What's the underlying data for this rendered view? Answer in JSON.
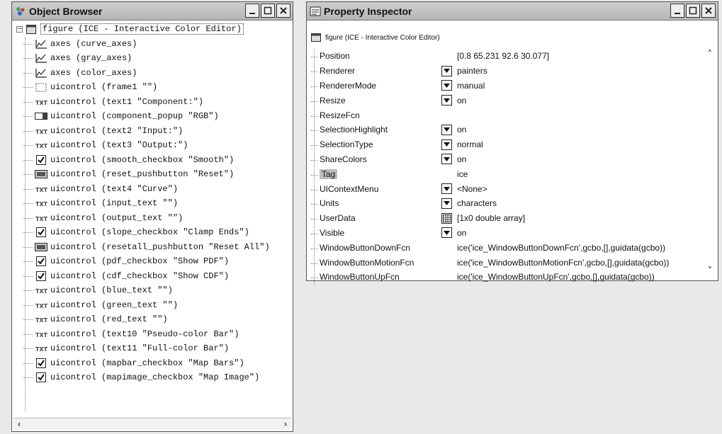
{
  "object_browser": {
    "title": "Object Browser",
    "root": {
      "expander": "−",
      "label": "figure (ICE - Interactive Color Editor)"
    },
    "items": [
      {
        "icon": "axes-icon",
        "label": "axes (curve_axes)"
      },
      {
        "icon": "axes-icon",
        "label": "axes (gray_axes)"
      },
      {
        "icon": "axes-icon",
        "label": "axes (color_axes)"
      },
      {
        "icon": "frame-icon",
        "label": "uicontrol (frame1 \"\")"
      },
      {
        "icon": "text-icon",
        "label": "uicontrol (text1 \"Component:\")"
      },
      {
        "icon": "popup-icon",
        "label": "uicontrol (component_popup \"RGB\")"
      },
      {
        "icon": "text-icon",
        "label": "uicontrol (text2 \"Input:\")"
      },
      {
        "icon": "text-icon",
        "label": "uicontrol (text3 \"Output:\")"
      },
      {
        "icon": "checkbox-icon",
        "label": "uicontrol (smooth_checkbox \"Smooth\")"
      },
      {
        "icon": "pushbutton-icon",
        "label": "uicontrol (reset_pushbutton \"Reset\")"
      },
      {
        "icon": "text-icon",
        "label": "uicontrol (text4 \"Curve\")"
      },
      {
        "icon": "text-icon",
        "label": "uicontrol (input_text \"\")"
      },
      {
        "icon": "text-icon",
        "label": "uicontrol (output_text \"\")"
      },
      {
        "icon": "checkbox-icon",
        "label": "uicontrol (slope_checkbox \"Clamp Ends\")"
      },
      {
        "icon": "pushbutton-icon",
        "label": "uicontrol (resetall_pushbutton \"Reset All\")"
      },
      {
        "icon": "checkbox-icon",
        "label": "uicontrol (pdf_checkbox \"Show PDF\")"
      },
      {
        "icon": "checkbox-icon",
        "label": "uicontrol (cdf_checkbox \"Show CDF\")"
      },
      {
        "icon": "text-icon",
        "label": "uicontrol (blue_text \"\")"
      },
      {
        "icon": "text-icon",
        "label": "uicontrol (green_text \"\")"
      },
      {
        "icon": "text-icon",
        "label": "uicontrol (red_text \"\")"
      },
      {
        "icon": "text-icon",
        "label": "uicontrol (text10 \"Pseudo-color Bar\")"
      },
      {
        "icon": "text-icon",
        "label": "uicontrol (text11 \"Full-color Bar\")"
      },
      {
        "icon": "checkbox-icon",
        "label": "uicontrol (mapbar_checkbox \"Map Bars\")"
      },
      {
        "icon": "checkbox-icon",
        "label": "uicontrol (mapimage_checkbox \"Map Image\")"
      }
    ]
  },
  "property_inspector": {
    "title": "Property Inspector",
    "object": "figure (ICE - Interactive Color Editor)",
    "properties": [
      {
        "name": "Position",
        "control": "expand",
        "value": "[0.8 65.231 92.6 30.077]"
      },
      {
        "name": "Renderer",
        "control": "dropdown",
        "value": "painters"
      },
      {
        "name": "RendererMode",
        "control": "dropdown",
        "value": "manual"
      },
      {
        "name": "Resize",
        "control": "dropdown",
        "value": "on"
      },
      {
        "name": "ResizeFcn",
        "control": "none",
        "value": ""
      },
      {
        "name": "SelectionHighlight",
        "control": "dropdown",
        "value": "on"
      },
      {
        "name": "SelectionType",
        "control": "dropdown",
        "value": "normal"
      },
      {
        "name": "ShareColors",
        "control": "dropdown",
        "value": "on"
      },
      {
        "name": "Tag",
        "control": "none",
        "value": "ice",
        "selected": true
      },
      {
        "name": "UIContextMenu",
        "control": "dropdown",
        "value": "<None>"
      },
      {
        "name": "Units",
        "control": "dropdown",
        "value": "characters"
      },
      {
        "name": "UserData",
        "control": "array",
        "value": "[1x0  double array]"
      },
      {
        "name": "Visible",
        "control": "dropdown",
        "value": "on"
      },
      {
        "name": "WindowButtonDownFcn",
        "control": "none",
        "value": "ice('ice_WindowButtonDownFcn',gcbo,[],guidata(gcbo))"
      },
      {
        "name": "WindowButtonMotionFcn",
        "control": "none",
        "value": "ice('ice_WindowButtonMotionFcn',gcbo,[],guidata(gcbo))"
      },
      {
        "name": "WindowButtonUpFcn",
        "control": "none",
        "value": "ice('ice_WindowButtonUpFcn',gcbo,[],guidata(gcbo))"
      }
    ]
  }
}
